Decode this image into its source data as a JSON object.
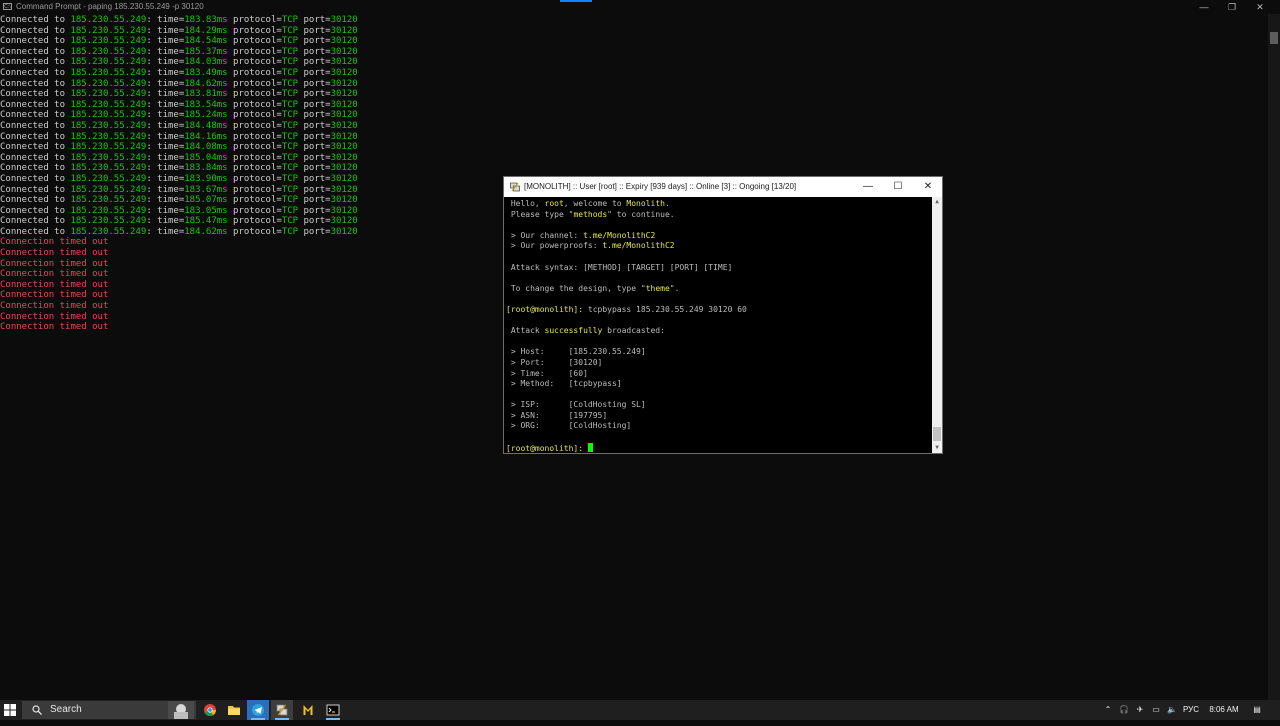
{
  "cmd": {
    "title": "Command Prompt - paping  185.230.55.249 -p 30120",
    "icon_text": "C:\\",
    "controls": {
      "minimize": "—",
      "maximize": "❐",
      "close": "✕"
    },
    "connected_prefix": "Connected to ",
    "ip": "185.230.55.249",
    "time_label": ": time=",
    "protocol_label": " protocol=",
    "protocol": "TCP",
    "port_label": " port=",
    "port": "30120",
    "times": [
      "183.83ms",
      "184.29ms",
      "184.54ms",
      "185.37ms",
      "184.03ms",
      "183.49ms",
      "184.62ms",
      "183.81ms",
      "183.54ms",
      "185.24ms",
      "184.48ms",
      "184.16ms",
      "184.08ms",
      "185.04ms",
      "183.84ms",
      "183.90ms",
      "183.67ms",
      "185.07ms",
      "183.05ms",
      "185.47ms",
      "184.62ms"
    ],
    "timeouts": [
      "Connection timed out",
      "Connection timed out",
      "Connection timed out",
      "Connection timed out",
      "Connection timed out",
      "Connection timed out",
      "Connection timed out",
      "Connection timed out",
      "Connection timed out"
    ]
  },
  "putty": {
    "title": "[MONOLITH] :: User [root] :: Expiry [939 days] :: Online [3] :: Ongoing [13/20]",
    "controls": {
      "minimize": "—",
      "maximize": "☐",
      "close": "✕"
    },
    "hello_pre": " Hello, ",
    "user": "root",
    "hello_mid": ", welcome to ",
    "brand": "Monolith",
    "hello_end": ".",
    "type_pre": " Please type \"",
    "methods": "methods",
    "type_post": "\" to continue.",
    "channel_label": " > Our channel: ",
    "channel": "t.me/MonolithC2",
    "proofs_label": " > Our powerproofs: ",
    "proofs": "t.me/MonolithC2",
    "syntax": " Attack syntax: [METHOD] [TARGET] [PORT] [TIME]",
    "design_pre": " To change the design, type \"",
    "theme": "theme",
    "design_post": "\".",
    "prompt": "[root@monolith]: ",
    "command": "tcpbypass 185.230.55.249 30120 60",
    "attack_pre": " Attack ",
    "attack_word": "successfully",
    "attack_post": " broadcasted:",
    "host": " > Host:     [185.230.55.249]",
    "port": " > Port:     [30120]",
    "time": " > Time:     [60]",
    "method": " > Method:   [tcpbypass]",
    "isp": " > ISP:      [ColdHosting SL]",
    "asn": " > ASN:      [197795]",
    "org": " > ORG:      [ColdHosting]",
    "prompt2": "[root@monolith]: "
  },
  "taskbar": {
    "search_label": "Search",
    "apps": [
      "chrome-icon",
      "folder-icon",
      "telegram-icon",
      "putty-icon",
      "monolith-icon",
      "cmd-icon"
    ],
    "language": "РУС",
    "clock": "8:06 AM"
  },
  "colors": {
    "green": "#16c60c",
    "red": "#e74856",
    "yellow": "#e5e54c",
    "cursor": "#00ff00"
  }
}
